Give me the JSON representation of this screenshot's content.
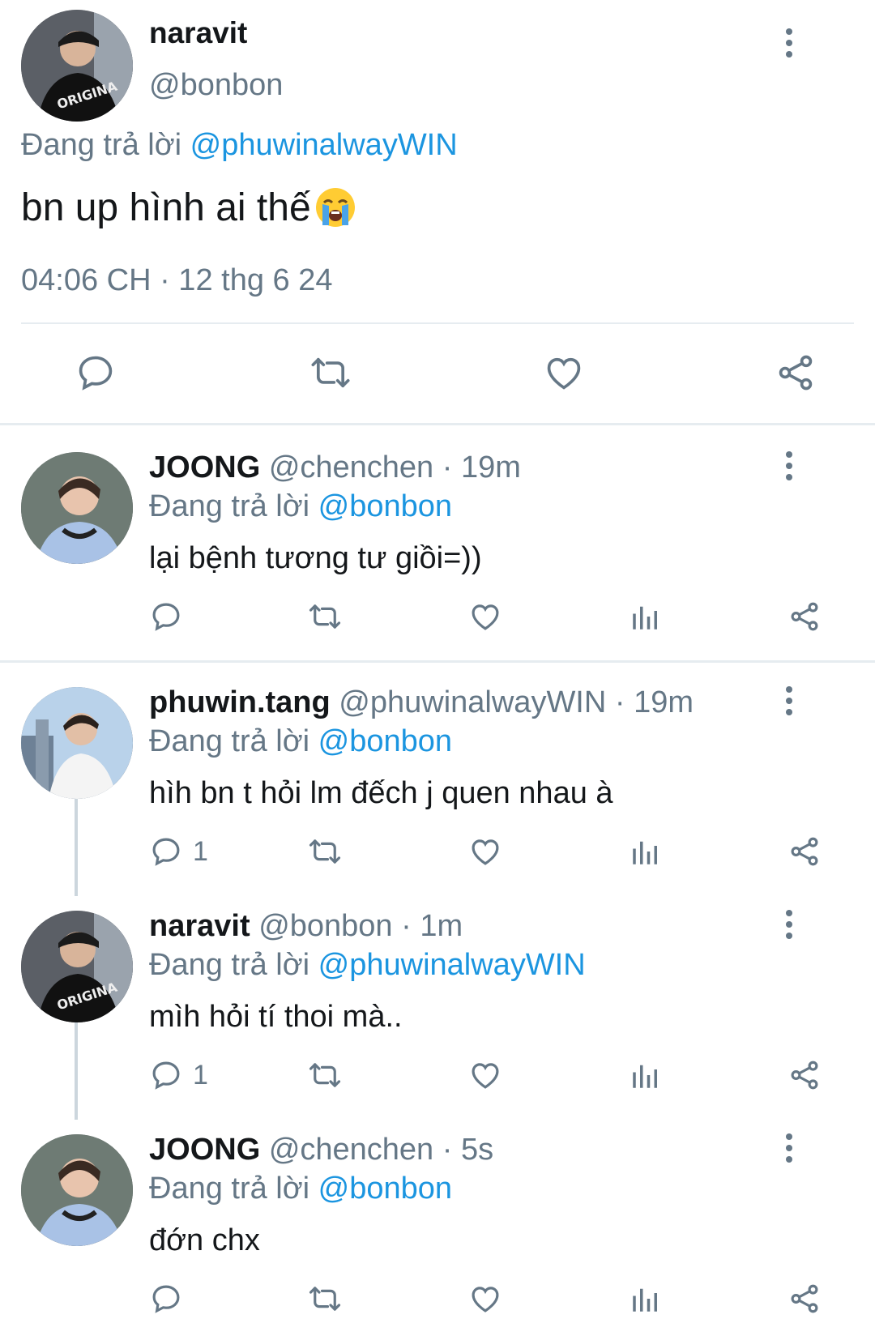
{
  "main_tweet": {
    "name": "naravit",
    "handle": "@bonbon",
    "replying_prefix": "Đang trả lời",
    "replying_to": "@phuwinalwayWIN",
    "text": "bn up hình ai thế",
    "emoji": "loudly-crying-face",
    "timestamp": "04:06 CH · 12 thg 6 24",
    "actions": [
      "reply-icon",
      "retweet-icon",
      "like-icon",
      "share-icon"
    ]
  },
  "replies": [
    {
      "name": "JOONG",
      "handle": "@chenchen · 19m",
      "replying_prefix": "Đang trả lời",
      "replying_to": "@bonbon",
      "text": "lại bệnh tương tư giồi=))",
      "reply_count": ""
    },
    {
      "name": "phuwin.tang",
      "handle": "@phuwinalwayWIN · 19m",
      "replying_prefix": "Đang trả lời",
      "replying_to": "@bonbon",
      "text": "hìh bn t hỏi lm đếch j quen nhau à",
      "reply_count": "1"
    },
    {
      "name": "naravit",
      "handle": "@bonbon · 1m",
      "replying_prefix": "Đang trả lời",
      "replying_to": "@phuwinalwayWIN",
      "text": "mìh hỏi tí thoi mà..",
      "reply_count": "1"
    },
    {
      "name": "JOONG",
      "handle": "@chenchen · 5s",
      "replying_prefix": "Đang trả lời",
      "replying_to": "@bonbon",
      "text": "đớn chx",
      "reply_count": ""
    }
  ],
  "colors": {
    "accent": "#1b95e0",
    "secondary_text": "#657786",
    "divider": "#e6ecf0",
    "thread_line": "#ccd6dd"
  }
}
